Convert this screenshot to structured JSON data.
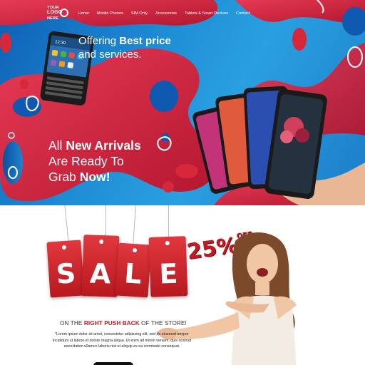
{
  "logo": {
    "line1": "YOUR",
    "line2": "LOGO",
    "line3": "HERE"
  },
  "nav": {
    "items": [
      {
        "label": "Home"
      },
      {
        "label": "Mobile Phones"
      },
      {
        "label": "SIM Only"
      },
      {
        "label": "Accessories"
      },
      {
        "label": "Tablets & Smart Devices"
      },
      {
        "label": "Contact"
      }
    ]
  },
  "hero": {
    "offer_prefix": "Offering ",
    "offer_bold": "Best price",
    "offer_line2": "and services.",
    "arrivals_1a": "All ",
    "arrivals_1b": "New Arrivals",
    "arrivals_2": "Are Ready To",
    "arrivals_3a": "Grab ",
    "arrivals_3b": "Now!",
    "phone_time": "12:30"
  },
  "sale": {
    "letters": [
      "S",
      "A",
      "L",
      "E"
    ],
    "discount": "25%",
    "discount_suffix": "OFF",
    "tagline_a": "ON THE ",
    "tagline_b": "RIGHT PUSH BACK",
    "tagline_c": " OF THE STORE!",
    "lorem": "\"Lorem ipsum dolor sit amet, consectetur adipiscing elit, sed do eiusmod tempor incididunt ut labore et dolore magna aliqua. Ut enim ad minim veniam, quis nostrud exercitation ullamco laboris nisi ut aliquip ex ea commodo consequat."
  },
  "colors": {
    "brand_red": "#d6283a",
    "brand_blue": "#1f8fd6",
    "sale_red": "#c21a24"
  }
}
